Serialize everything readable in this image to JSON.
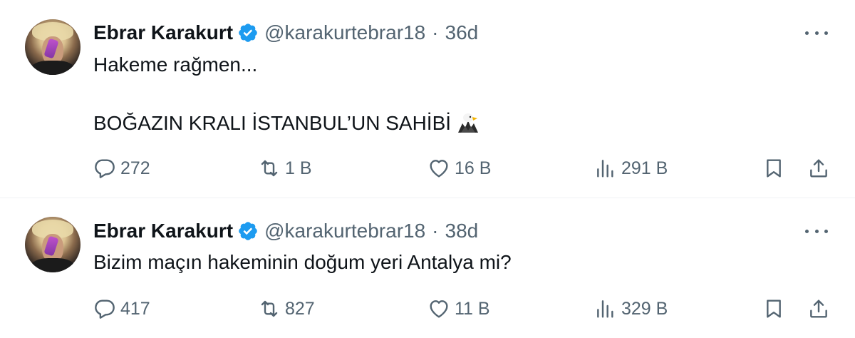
{
  "tweets": [
    {
      "author": {
        "name": "Ebrar Karakurt",
        "handle": "@karakurtebrar18",
        "verified": true
      },
      "time": "36d",
      "lines": [
        "Hakeme rağmen...",
        "BOĞAZIN KRALI İSTANBUL’UN SAHİBİ"
      ],
      "emoji": "eagle",
      "stats": {
        "replies": "272",
        "reposts": "1 B",
        "likes": "16 B",
        "views": "291 B"
      }
    },
    {
      "author": {
        "name": "Ebrar Karakurt",
        "handle": "@karakurtebrar18",
        "verified": true
      },
      "time": "38d",
      "lines": [
        "Bizim maçın hakeminin doğum yeri Antalya mi?"
      ],
      "stats": {
        "replies": "417",
        "reposts": "827",
        "likes": "11 B",
        "views": "329 B"
      }
    }
  ],
  "colors": {
    "text": "#0f1419",
    "muted": "#536471",
    "verified": "#1d9bf0",
    "divider": "#eff3f4"
  },
  "icons": [
    "verified-badge-icon",
    "more-icon",
    "reply-icon",
    "repost-icon",
    "like-icon",
    "views-icon",
    "bookmark-icon",
    "share-icon",
    "eagle-emoji-icon"
  ]
}
